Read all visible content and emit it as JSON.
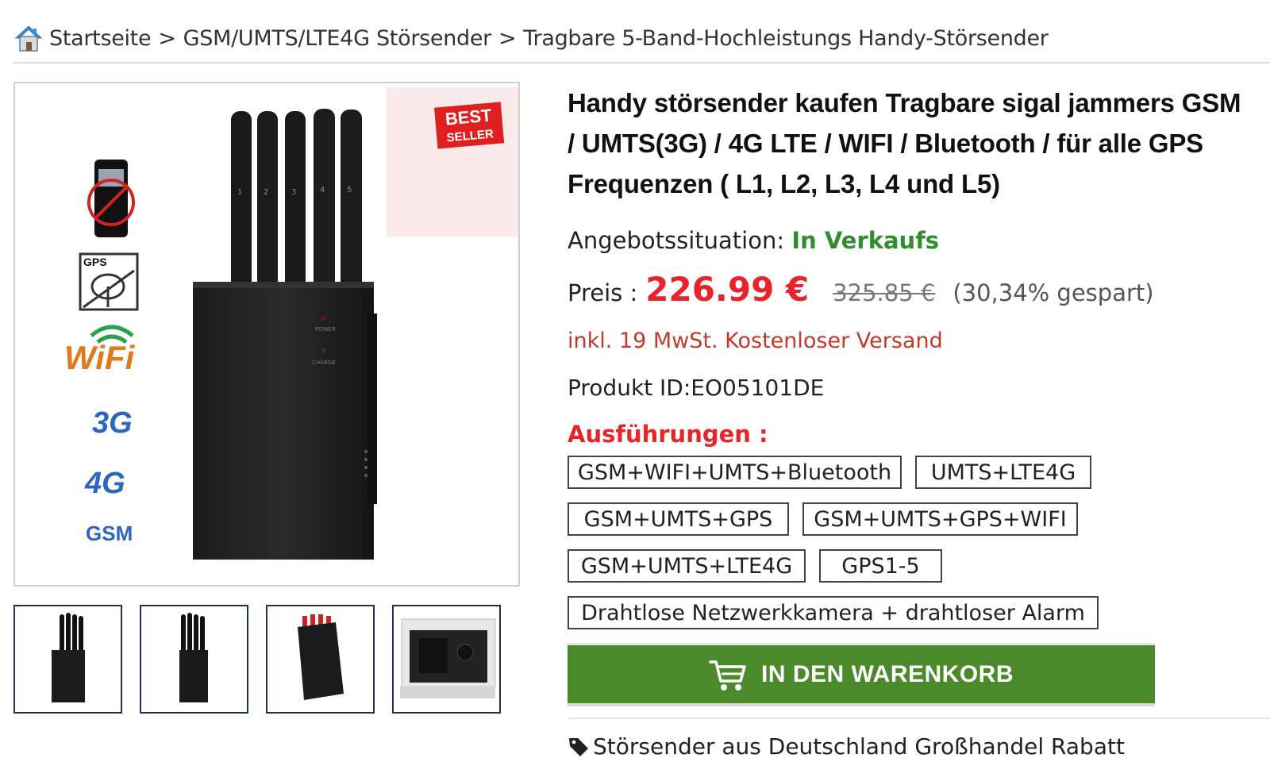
{
  "breadcrumb": {
    "items": [
      {
        "label": "Startseite"
      },
      {
        "label": "GSM/UMTS/LTE4G Störsender"
      },
      {
        "label": "Tragbare 5-Band-Hochleistungs Handy-Störsender"
      }
    ],
    "separator": ">"
  },
  "gallery": {
    "badge_line1": "BEST",
    "badge_line2": "SELLER",
    "feature_labels": {
      "gps": "GPS",
      "wifi": "WiFi",
      "g3": "3G",
      "g4": "4G",
      "gsm": "GSM"
    },
    "device_labels": {
      "power": "POWER",
      "charge": "CHARGE"
    },
    "antenna_numbers": [
      "1",
      "2",
      "3",
      "4",
      "5"
    ],
    "thumbnail_count": 4
  },
  "product": {
    "title": "Handy störsender kaufen Tragbare sigal jammers GSM / UMTS(3G) / 4G LTE / WIFI / Bluetooth / für alle GPS Frequenzen ( L1, L2, L3, L4 und L5)",
    "availability_label": "Angebotssituation: ",
    "availability_status": "In Verkaufs",
    "price_label": "Preis :",
    "price_current": "226.99 €",
    "price_old": "325.85 €",
    "price_saved": "(30,34% gespart)",
    "vat_note": "inkl. 19 MwSt. Kostenloser Versand",
    "product_id": "Produkt ID:EO05101DE",
    "options_label": "Ausführungen :",
    "options": [
      "GSM+WIFI+UMTS+Bluetooth",
      "UMTS+LTE4G",
      "GSM+UMTS+GPS",
      "GSM+UMTS+GPS+WIFI",
      "GSM+UMTS+LTE4G",
      "GPS1-5",
      "Drahtlose Netzwerkkamera + drahtloser Alarm"
    ],
    "cart_button_label": "IN DEN WARENKORB",
    "wholesale_text": "Störsender aus Deutschland Großhandel Rabatt"
  },
  "colors": {
    "price_red": "#e8232a",
    "status_green": "#2f8f2f",
    "cart_green": "#4a8a2a",
    "vat_red": "#c0392b"
  },
  "icons": [
    "home-icon",
    "cart-icon",
    "tag-icon"
  ]
}
